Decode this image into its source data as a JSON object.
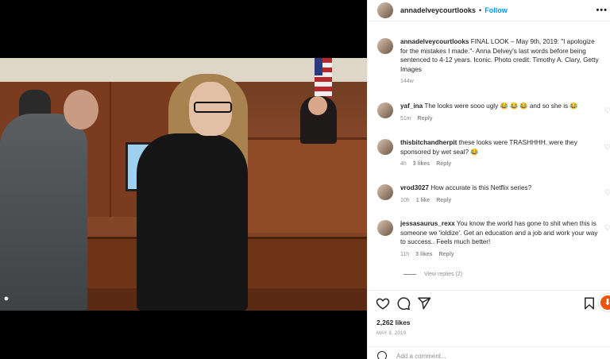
{
  "header": {
    "username": "annadelveycourtlooks",
    "separator": "•",
    "follow_label": "Follow",
    "more_label": "•••"
  },
  "caption": {
    "username": "annadelveycourtlooks",
    "text": "FINAL LOOK – May 9th, 2019: \"I apologize for the mistakes I made.\"- Anna Delvey's last words before being sentenced to 4-12 years. Iconic. Photo credit: Timothy A. Clary, Getty Images",
    "time": "144w"
  },
  "comments": [
    {
      "username": "yaf_ina",
      "text": "The looks were sooo ugly 😂 😂 😂 and so she is 😂",
      "time": "51m",
      "likes": "",
      "reply": "Reply"
    },
    {
      "username": "thisbitchandherpit",
      "text": "these looks were TRASHHHH. were they sponsored by wet seal? 😂",
      "time": "4h",
      "likes": "3 likes",
      "reply": "Reply"
    },
    {
      "username": "vrod3027",
      "text": "How accurate is this Netflix series?",
      "time": "10h",
      "likes": "1 like",
      "reply": "Reply"
    },
    {
      "username": "jessasaurus_rexx",
      "text": "You know the world has gone to shit when this is someone we 'ioldize'. Get an education and a job and work your way to success.. Feels much better!",
      "time": "11h",
      "likes": "3 likes",
      "reply": "Reply"
    }
  ],
  "view_replies": "View replies (2)",
  "likes": "2,262 likes",
  "date": "MAY 9, 2019",
  "add_comment_placeholder": "Add a comment...",
  "icons": {
    "like": "heart-icon",
    "comment": "comment-icon",
    "share": "send-icon",
    "save": "bookmark-icon",
    "fab": "download-arrow-icon"
  },
  "colors": {
    "accent": "#0095f6",
    "text": "#262626",
    "muted": "#8e8e8e",
    "fab": "#e8550f"
  }
}
